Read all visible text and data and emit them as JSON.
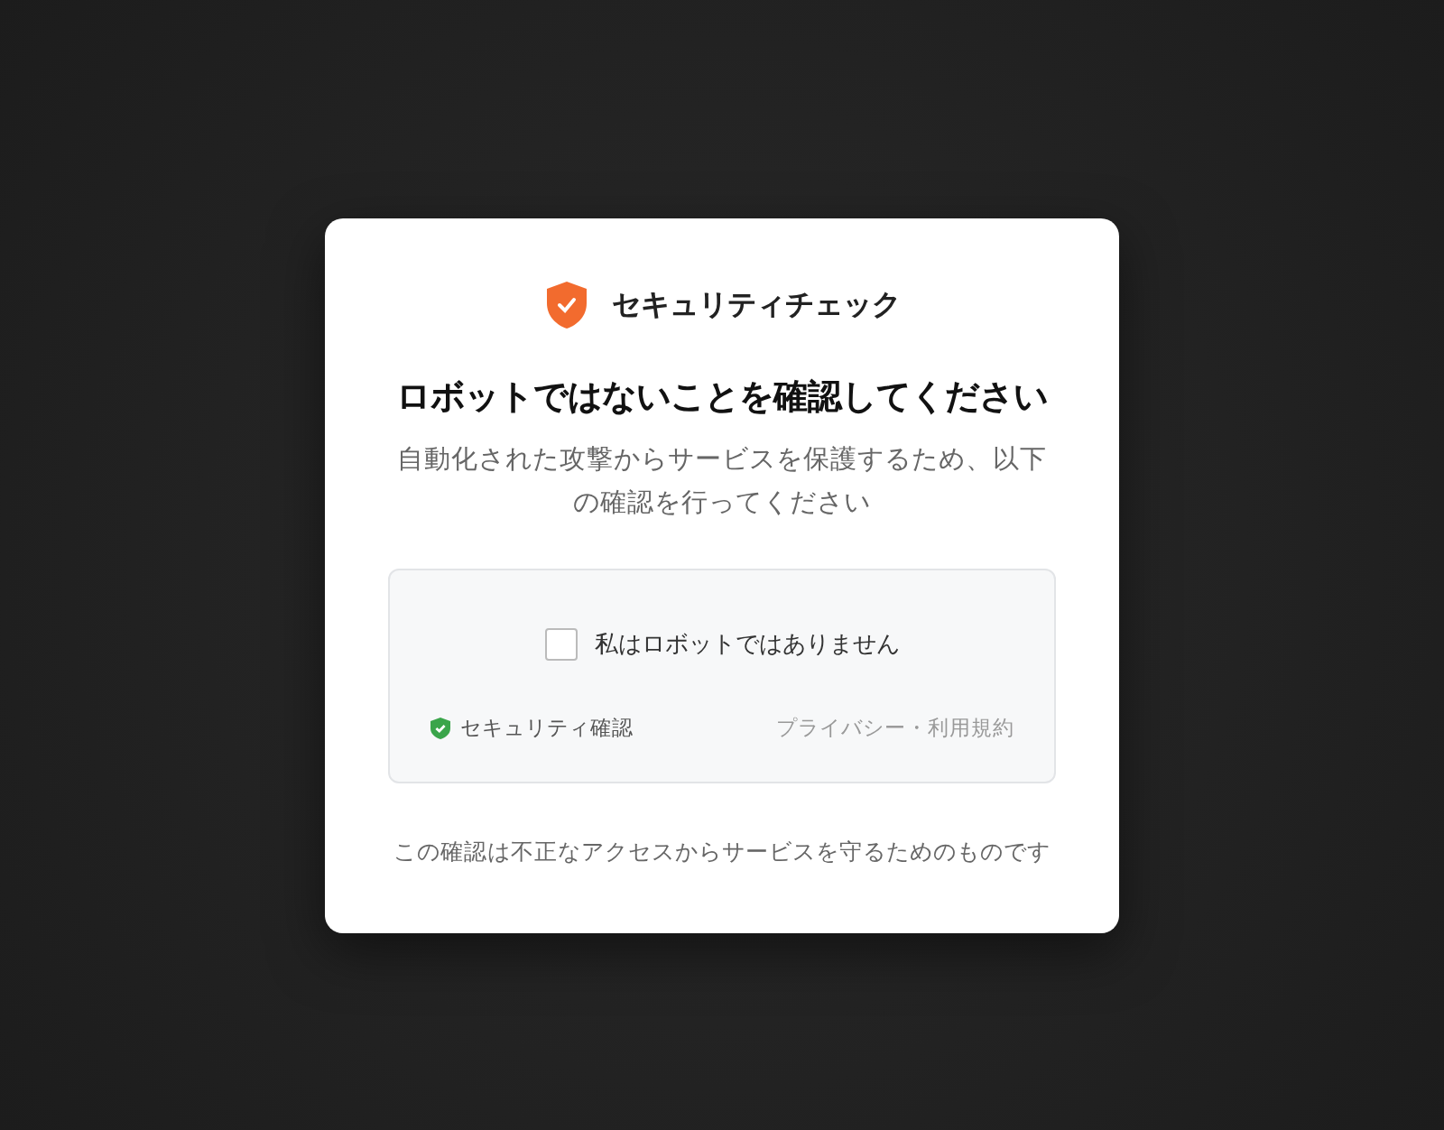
{
  "brand": {
    "title": "セキュリティチェック"
  },
  "heading": "ロボットではないことを確認してください",
  "description": "自動化された攻撃からサービスを保護するため、以下の確認を行ってください",
  "captcha": {
    "checkbox": {
      "label": "私はロボットではありません",
      "checked": false
    },
    "badge": "セキュリティ確認",
    "links": "プライバシー・利用規約"
  },
  "footer": "この確認は不正なアクセスからサービスを守るためのものです"
}
